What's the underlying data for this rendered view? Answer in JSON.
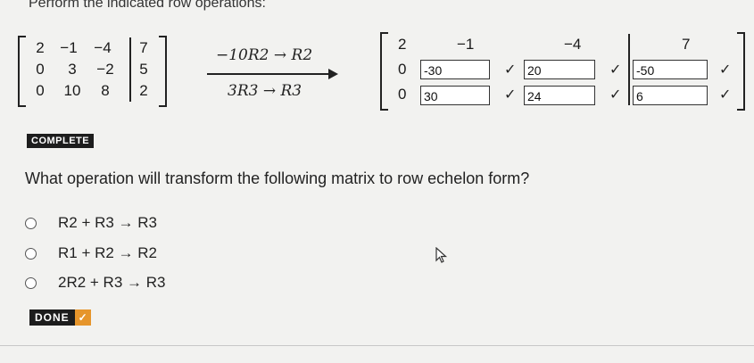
{
  "instruction": "Perform the indicated row operations:",
  "left_matrix": {
    "rows": [
      [
        "2",
        "−1",
        "−4",
        "7"
      ],
      [
        "0",
        "3",
        "−2",
        "5"
      ],
      [
        "0",
        "10",
        "8",
        "2"
      ]
    ]
  },
  "operations": {
    "top": "−10R2 → R2",
    "bottom": "3R3 → R3"
  },
  "result_matrix": {
    "row1": [
      "2",
      "−1",
      "−4",
      "7"
    ],
    "row2_first": "0",
    "row3_first": "0",
    "inputs": {
      "r2c2": "-30",
      "r2c3": "20",
      "r2c4": "-50",
      "r3c2": "30",
      "r3c3": "24",
      "r3c4": "6"
    },
    "check_mark": "✓"
  },
  "status_badge": "COMPLETE",
  "question": "What operation will transform the following matrix to row echelon form?",
  "options": [
    {
      "label": "R2 + R3 → R3"
    },
    {
      "label": "R1 + R2 → R2"
    },
    {
      "label": "2R2 + R3 → R3"
    }
  ],
  "done_badge": {
    "text": "DONE",
    "check": "✓"
  },
  "colors": {
    "done_accent": "#e6952b",
    "badge_bg": "#1d1d1d",
    "background": "#f2f2f0"
  },
  "icons": {
    "cursor": "pointer-cursor-icon",
    "check": "check-icon",
    "radio": "radio-empty-icon"
  }
}
